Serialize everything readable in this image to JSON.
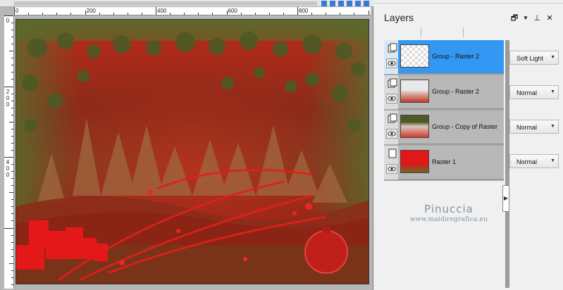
{
  "rulers": {
    "horizontal_labels": [
      "0",
      "200",
      "400",
      "600",
      "800"
    ],
    "vertical_labels": [
      [
        "0"
      ],
      [
        "2",
        "0",
        "0"
      ],
      [
        "4",
        "0",
        "0"
      ]
    ]
  },
  "panel": {
    "title": "Layers",
    "header_icons": [
      "restore-icon",
      "dropdown-arrow-icon",
      "pin-icon",
      "close-icon"
    ]
  },
  "layers": [
    {
      "name": "Group - Raster 2",
      "blend": "Soft Light",
      "selected": true
    },
    {
      "name": "Group - Raster 2",
      "blend": "Normal",
      "selected": false
    },
    {
      "name": "Group - Copy of Raster",
      "blend": "Normal",
      "selected": false
    },
    {
      "name": "Raster 1",
      "blend": "Normal",
      "selected": false
    }
  ],
  "watermark": {
    "name": "Pinuccia",
    "site": "www.maidiregrafica.eu"
  },
  "colors": {
    "selection": "#3398f3",
    "canvas_red": "#c8201a",
    "canvas_dark": "#6b2415",
    "canvas_green": "#5e6a2c",
    "watermark": "#7d93ad"
  }
}
